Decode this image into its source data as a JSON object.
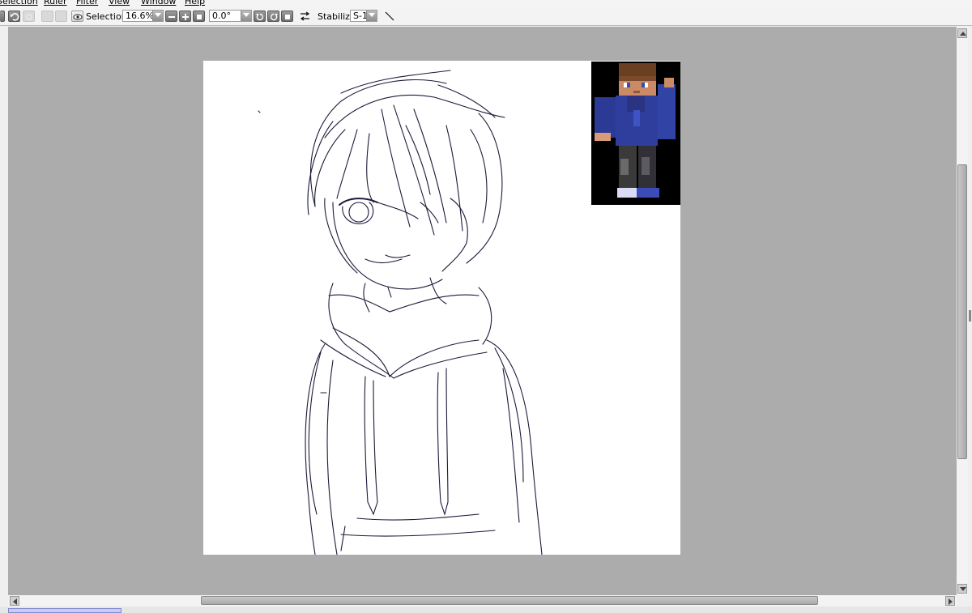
{
  "menubar": {
    "items": [
      {
        "label": "Selection"
      },
      {
        "label": "Ruler"
      },
      {
        "label": "Filter"
      },
      {
        "label": "View"
      },
      {
        "label": "Window"
      },
      {
        "label": "Help"
      }
    ]
  },
  "toolbar": {
    "undo_icon": "undo-icon",
    "redo_icon": "redo-icon",
    "selection_visibility_icon": "eye-icon",
    "selection_label": "Selection",
    "zoom_value": "16.6%",
    "zoom_out_icon": "minus-icon",
    "zoom_in_icon": "plus-icon",
    "zoom_reset_icon": "square-icon",
    "rotation_value": "0.0°",
    "rotate_ccw_icon": "rotate-left-icon",
    "rotate_cw_icon": "rotate-right-icon",
    "rotation_reset_icon": "square-icon",
    "flip_icon": "flip-horizontal-icon",
    "stabilizer_label": "Stabilizer",
    "stabilizer_value": "S-1",
    "straight_line_icon": "straight-line-icon"
  },
  "colors": {
    "workspace_bg": "#acacac",
    "canvas_bg": "#ffffff",
    "sketch_stroke": "#1b1b3a",
    "toolbar_border": "#e2b487",
    "layer_tab_highlight": "#c9cdf2"
  }
}
